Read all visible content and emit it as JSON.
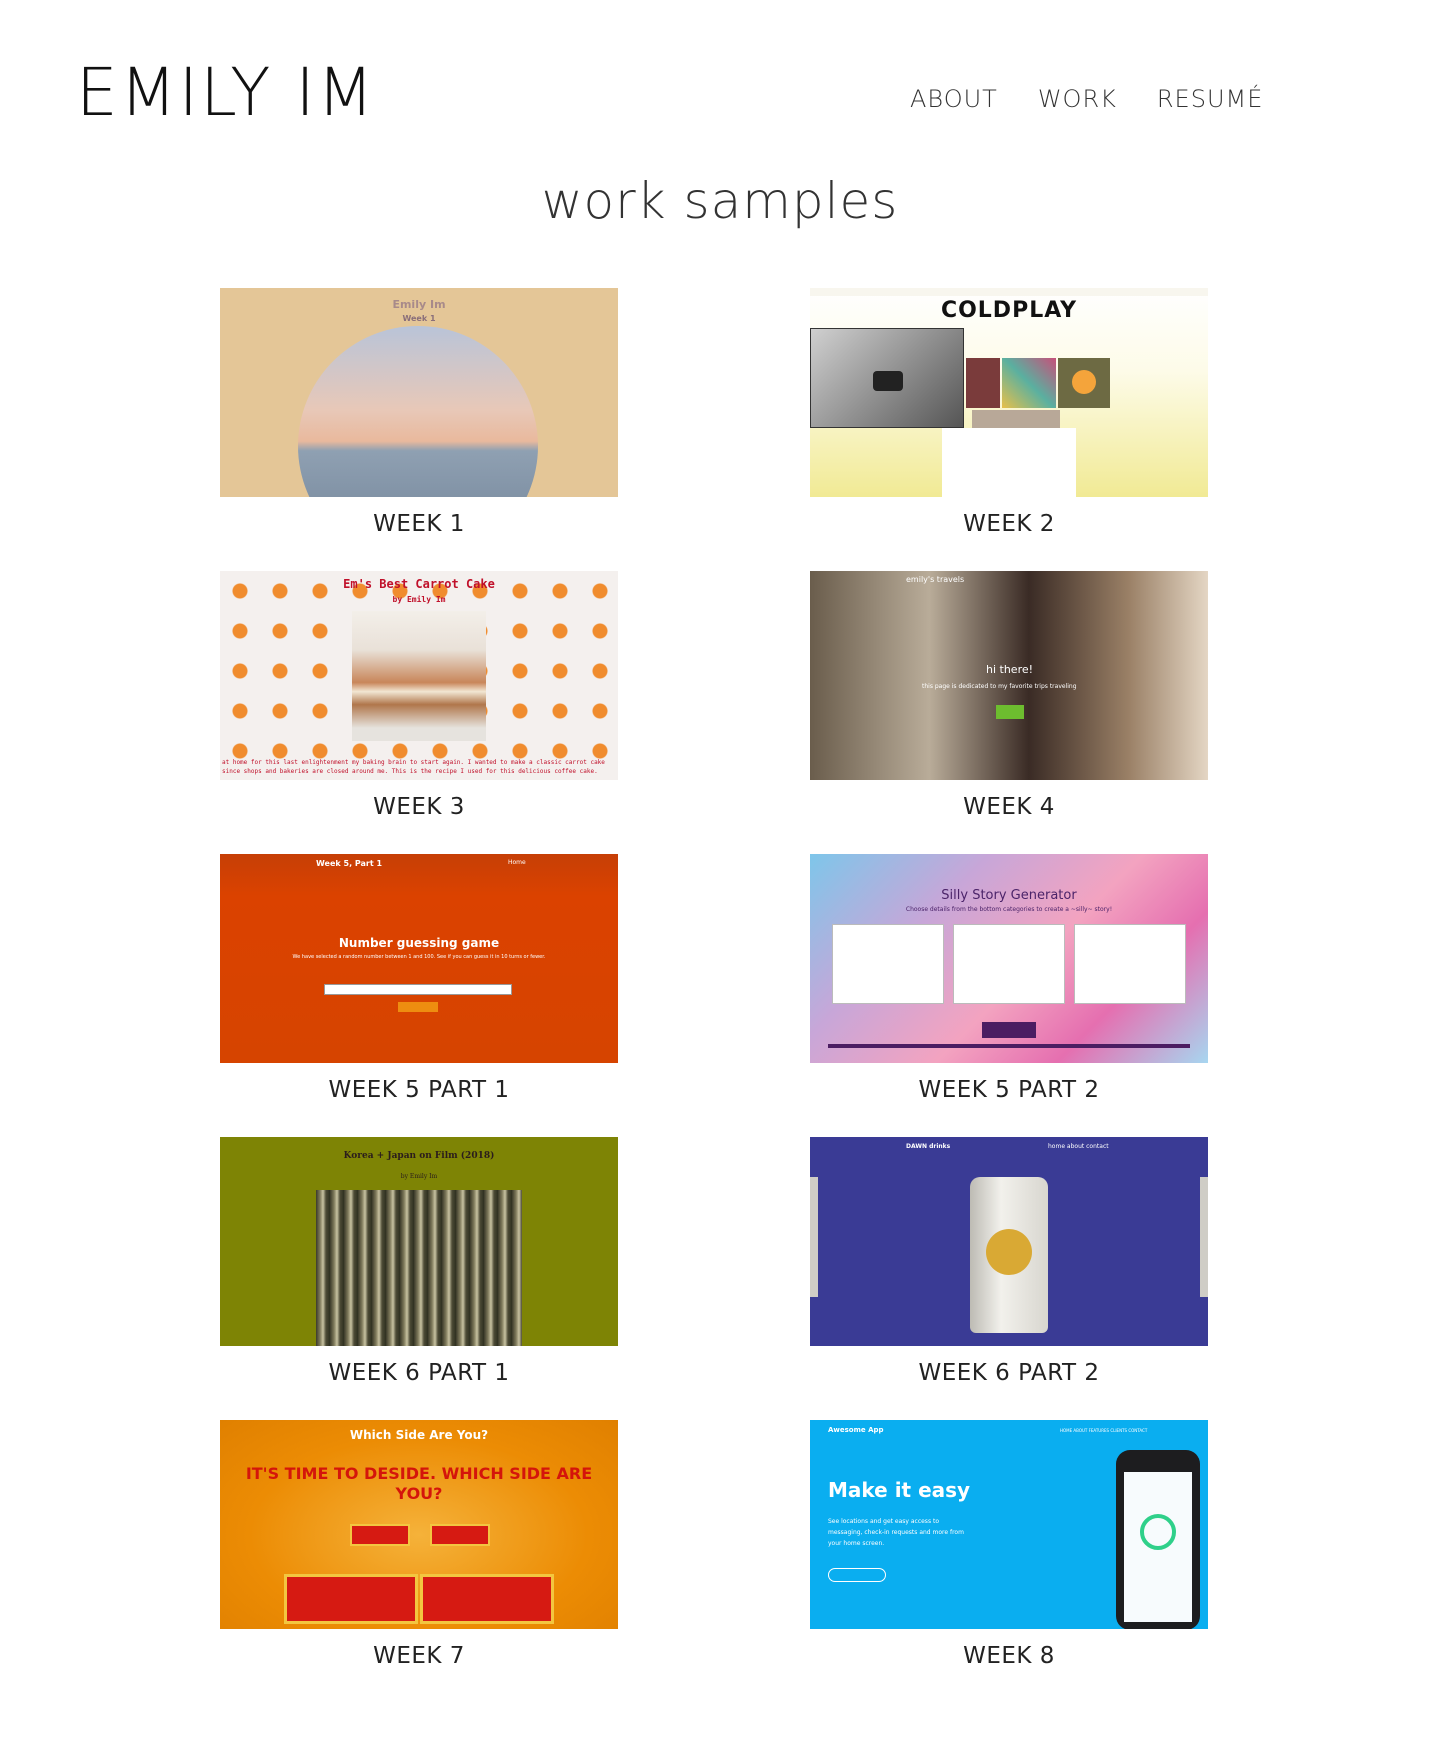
{
  "site": {
    "name": "EMILY IM",
    "nav": [
      "ABOUT",
      "WORK",
      "RESUMÉ"
    ]
  },
  "page_title": "work samples",
  "samples": [
    {
      "label": "WEEK 1",
      "thumb_text": {
        "name": "Emily Im",
        "sub": "Week 1"
      }
    },
    {
      "label": "WEEK 2",
      "thumb_text": {
        "brand": "COLDPLAY"
      }
    },
    {
      "label": "WEEK 3",
      "thumb_text": {
        "title": "Em's Best Carrot Cake",
        "by": "by Emily Im",
        "body": "at home for this last enlightenment my baking brain to start again. I wanted to make a classic carrot cake since shops and bakeries are closed around me. This is the recipe I used for this delicious coffee cake."
      }
    },
    {
      "label": "WEEK 4",
      "thumb_text": {
        "header": "emily's travels",
        "hi": "hi there!",
        "line": "this page is dedicated to my favorite trips traveling"
      }
    },
    {
      "label": "WEEK 5 PART 1",
      "thumb_text": {
        "top": "Week 5, Part 1",
        "home": "Home",
        "heading": "Number guessing game",
        "para": "We have selected a random number between 1 and 100. See if you can guess it in 10 turns or fewer."
      }
    },
    {
      "label": "WEEK 5 PART 2",
      "thumb_text": {
        "heading": "Silly Story Generator",
        "sub": "Choose details from the bottom categories to create a ~silly~ story!"
      }
    },
    {
      "label": "WEEK 6 PART 1",
      "thumb_text": {
        "heading": "Korea + Japan on Film (2018)",
        "by": "by Emily Im"
      }
    },
    {
      "label": "WEEK 6 PART 2",
      "thumb_text": {
        "brand": "DAWN drinks",
        "menu": "home  about  contact"
      }
    },
    {
      "label": "WEEK 7",
      "thumb_text": {
        "heading": "Which Side Are You?",
        "slogan": "IT'S TIME TO DESIDE. WHICH SIDE ARE YOU?"
      }
    },
    {
      "label": "WEEK 8",
      "thumb_text": {
        "app": "Awesome App",
        "menu": "HOME  ABOUT  FEATURES  CLIENTS  CONTACT",
        "heading": "Make it easy",
        "desc": "See locations and get easy access to messaging, check-in requests and more from your home screen."
      }
    }
  ]
}
